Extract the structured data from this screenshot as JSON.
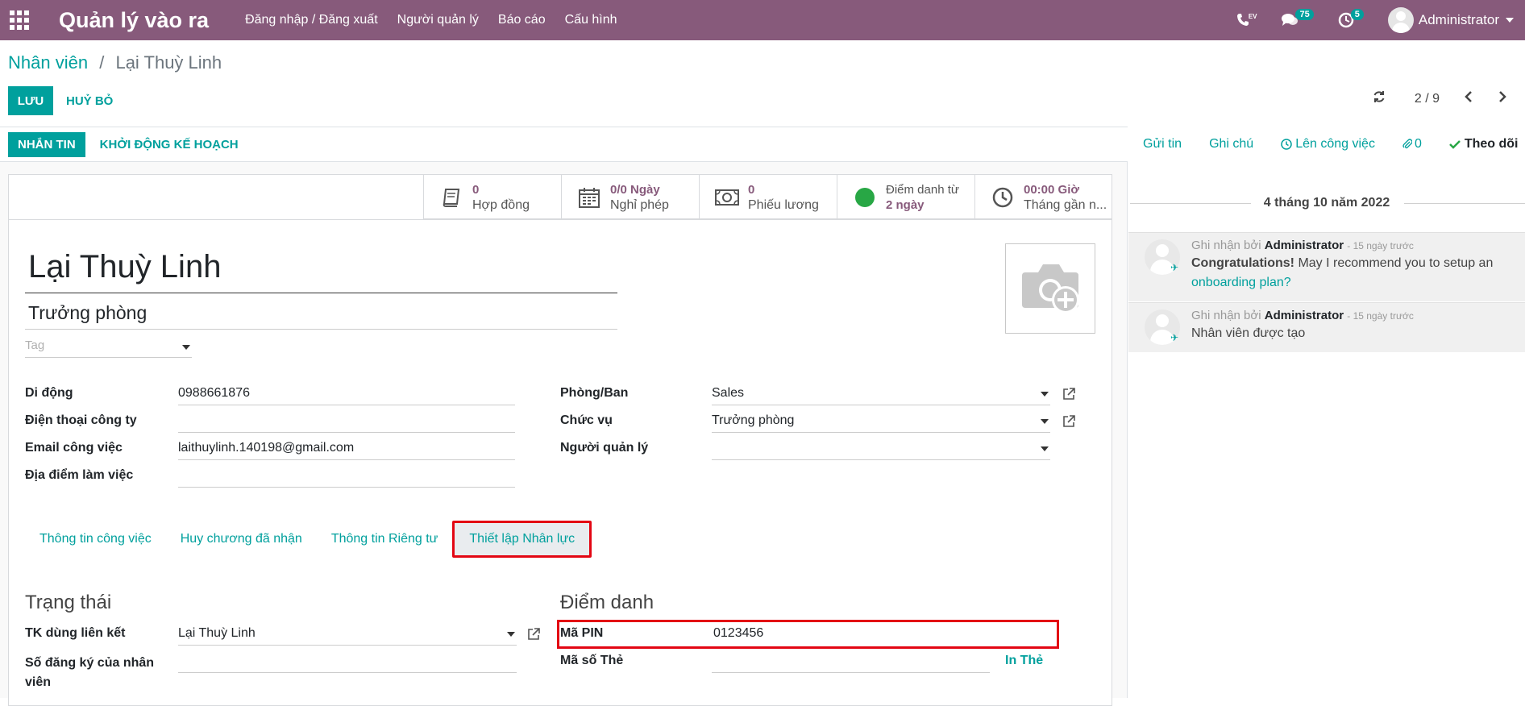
{
  "navbar": {
    "brand": "Quản lý vào ra",
    "menu": [
      "Đăng nhập / Đăng xuất",
      "Người quản lý",
      "Báo cáo",
      "Cấu hình"
    ],
    "phone_label": "EV",
    "messages_count": "75",
    "activities_count": "5",
    "user_name": "Administrator"
  },
  "breadcrumb": {
    "parent": "Nhân viên",
    "current": "Lại Thuỳ Linh"
  },
  "actions": {
    "save": "LƯU",
    "discard": "HUỶ BỎ"
  },
  "pager": {
    "value": "2 / 9"
  },
  "statusbar": {
    "send_message": "NHẮN TIN",
    "launch_plan": "KHỞI ĐỘNG KẾ HOẠCH"
  },
  "stat_buttons": {
    "contracts": {
      "value": "0",
      "label": "Hợp đồng"
    },
    "time_off": {
      "value": "0/0 Ngày",
      "label": "Nghỉ phép"
    },
    "payslips": {
      "value": "0",
      "label": "Phiếu lương"
    },
    "attendance": {
      "label": "Điểm danh từ",
      "value": "2 ngày",
      "status_color": "#28a745"
    },
    "hours": {
      "value": "00:00 Giờ",
      "label": "Tháng gần n..."
    }
  },
  "employee": {
    "name": "Lại Thuỳ Linh",
    "job_title": "Trưởng phòng",
    "tag_placeholder": "Tag"
  },
  "fields_left": {
    "mobile": {
      "label": "Di động",
      "value": "0988661876"
    },
    "work_phone": {
      "label": "Điện thoại công ty",
      "value": ""
    },
    "work_email": {
      "label": "Email công việc",
      "value": "laithuylinh.140198@gmail.com"
    },
    "work_location": {
      "label": "Địa điểm làm việc",
      "value": ""
    }
  },
  "fields_right": {
    "department": {
      "label": "Phòng/Ban",
      "value": "Sales"
    },
    "job_position": {
      "label": "Chức vụ",
      "value": "Trưởng phòng"
    },
    "manager": {
      "label": "Người quản lý",
      "value": ""
    }
  },
  "tabs": [
    "Thông tin công việc",
    "Huy chương đã nhận",
    "Thông tin Riêng tư",
    "Thiết lập Nhân lực"
  ],
  "status_group": {
    "title": "Trạng thái",
    "related_user": {
      "label": "TK dùng liên kết",
      "value": "Lại Thuỳ Linh"
    },
    "registration_number": {
      "label": "Số đăng ký của nhân viên",
      "value": ""
    }
  },
  "attendance_group": {
    "title": "Điểm danh",
    "pin": {
      "label": "Mã PIN",
      "value": "0123456"
    },
    "badge": {
      "label": "Mã số Thẻ",
      "value": ""
    },
    "print_badge": "In Thẻ"
  },
  "chatter": {
    "send_message": "Gửi tin",
    "log_note": "Ghi chú",
    "schedule_activity": "Lên công việc",
    "attachments_count": "0",
    "follow": "Theo dõi",
    "date": "4 tháng 10 năm 2022",
    "messages": [
      {
        "prefix": "Ghi nhận bởi",
        "author": "Administrator",
        "ago": "- 15 ngày trước",
        "bold": "Congratulations!",
        "text": " May I recommend you to setup an ",
        "link": "onboarding plan?"
      },
      {
        "prefix": "Ghi nhận bởi",
        "author": "Administrator",
        "ago": "- 15 ngày trước",
        "text": "Nhân viên được tạo"
      }
    ]
  },
  "colors": {
    "navbar": "#875a7b",
    "accent": "#00a09d",
    "highlight": "#e30613"
  }
}
